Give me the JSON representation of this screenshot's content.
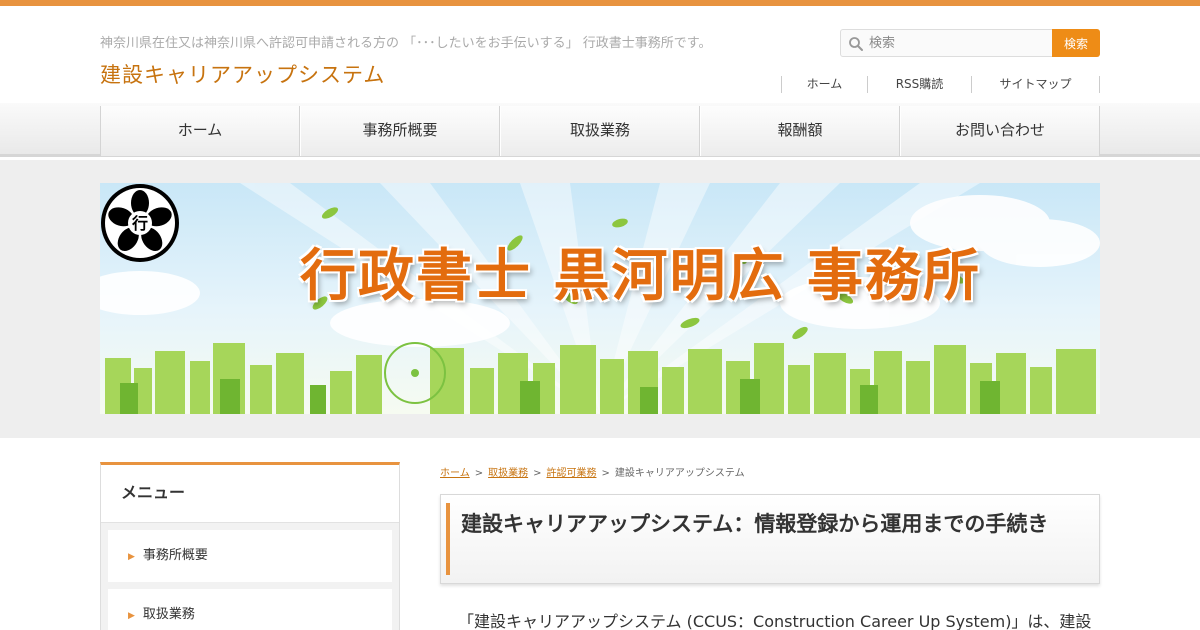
{
  "header": {
    "tagline": "神奈川県在住又は神奈川県へ許認可申請される方の 「･･･したいをお手伝いする」 行政書士事務所です。",
    "site_title": "建設キャリアアップシステム"
  },
  "search": {
    "placeholder": "検索",
    "button_label": "検索",
    "icon": "search-icon"
  },
  "util_nav": [
    "ホーム",
    "RSS購読",
    "サイトマップ"
  ],
  "global_nav": [
    "ホーム",
    "事務所概要",
    "取扱業務",
    "報酬額",
    "お問い合わせ"
  ],
  "hero": {
    "title": "行政書士 黒河明広 事務所",
    "emblem": "cherry-blossom-emblem",
    "emblem_text": "行"
  },
  "sidebar": {
    "heading": "メニュー",
    "items": [
      "事務所概要",
      "取扱業務"
    ]
  },
  "breadcrumb": {
    "items": [
      "ホーム",
      "取扱業務",
      "許認可業務"
    ],
    "current": "建設キャリアアップシステム",
    "separator": ">"
  },
  "post": {
    "title": "建設キャリアアップシステム：情報登録から運用までの手続き",
    "intro": "「建設キャリアアップシステム (CCUS：Construction Career Up System)」は、建設"
  },
  "colors": {
    "accent": "#e8933f",
    "title_orange": "#c7730f",
    "hero_title": "#e36c0e",
    "search_button": "#ee8c16"
  }
}
